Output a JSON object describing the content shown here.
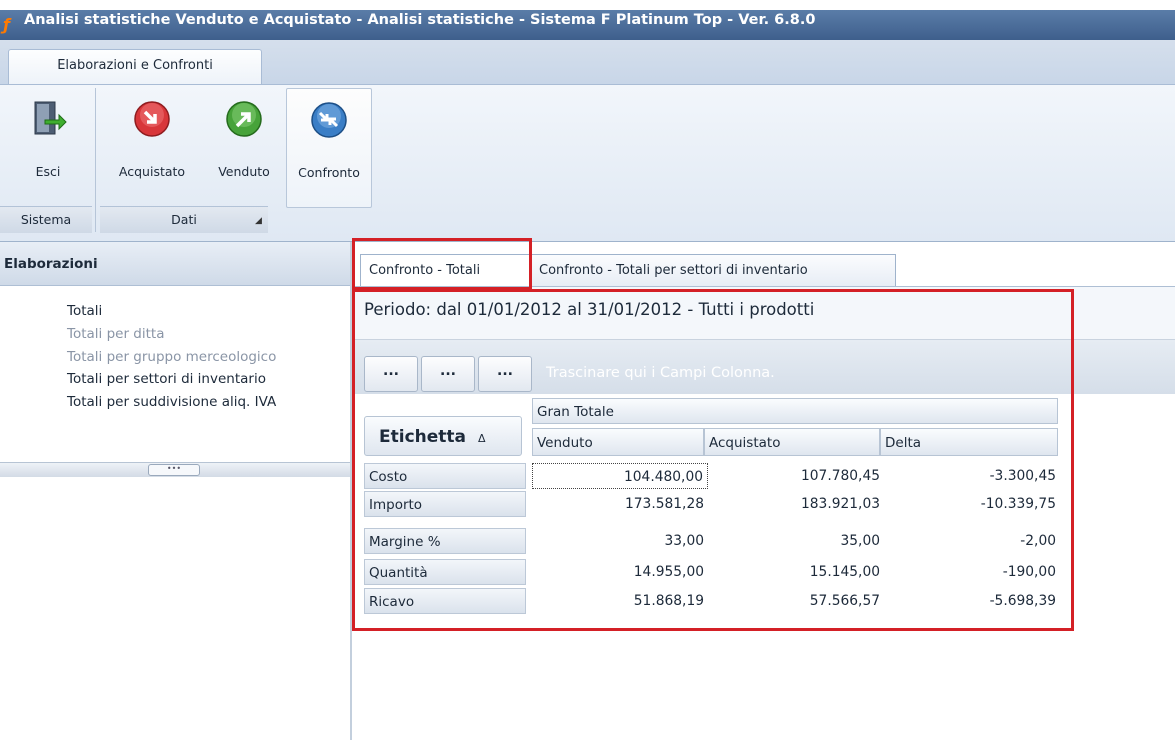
{
  "window": {
    "title": "Analisi statistiche Venduto e Acquistato - Analisi statistiche - Sistema F Platinum Top - Ver. 6.8.0"
  },
  "ribbon": {
    "tab_label": "Elaborazioni e Confronti",
    "buttons": {
      "esci": "Esci",
      "acquistato": "Acquistato",
      "venduto": "Venduto",
      "confronto": "Confronto"
    },
    "groups": {
      "sistema": "Sistema",
      "dati": "Dati"
    }
  },
  "left_panel": {
    "header": "Elaborazioni",
    "items": [
      {
        "label": "Totali",
        "state": "normal"
      },
      {
        "label": "Totali per ditta",
        "state": "disabled"
      },
      {
        "label": "Totali per gruppo merceologico",
        "state": "disabled"
      },
      {
        "label": "Totali per settori di inventario",
        "state": "normal"
      },
      {
        "label": "Totali per suddivisione aliq. IVA",
        "state": "normal"
      }
    ]
  },
  "doc_tabs": [
    {
      "label": "Confronto - Totali",
      "active": true
    },
    {
      "label": "Confronto - Totali per settori di inventario",
      "active": false
    }
  ],
  "period": "Periodo: dal 01/01/2012 al 31/01/2012 - Tutti i prodotti",
  "pivot": {
    "field_buttons": [
      "...",
      "...",
      "..."
    ],
    "drop_hint": "Trascinare qui i Campi Colonna.",
    "row_field": "Etichetta",
    "sort_icon": "Δ",
    "group_header": "Gran Totale",
    "columns": [
      "Venduto",
      "Acquistato",
      "Delta"
    ],
    "rows": [
      {
        "label": "Costo",
        "values": [
          "104.480,00",
          "107.780,45",
          "-3.300,45"
        ]
      },
      {
        "label": "Importo",
        "values": [
          "173.581,28",
          "183.921,03",
          "-10.339,75"
        ]
      },
      {
        "label": "Margine %",
        "values": [
          "33,00",
          "35,00",
          "-2,00"
        ]
      },
      {
        "label": "Quantità",
        "values": [
          "14.955,00",
          "15.145,00",
          "-190,00"
        ]
      },
      {
        "label": "Ricavo",
        "values": [
          "51.868,19",
          "57.566,57",
          "-5.698,39"
        ]
      }
    ]
  },
  "colors": {
    "highlight": "#d42026",
    "title_bar": "#3e5f8c"
  }
}
